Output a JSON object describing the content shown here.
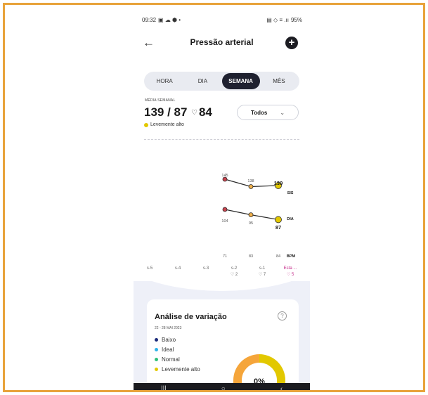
{
  "status_bar": {
    "time": "09:32",
    "left_icons": "▣ ☁ ⬢ •",
    "right_icons": "▤ ◇ ≡ .ıı",
    "battery": "95%"
  },
  "header": {
    "title": "Pressão arterial",
    "back_icon": "←",
    "add_icon": "+"
  },
  "tabs": [
    {
      "label": "HORA",
      "active": false
    },
    {
      "label": "DIA",
      "active": false
    },
    {
      "label": "SEMANA",
      "active": true
    },
    {
      "label": "MÊS",
      "active": false
    }
  ],
  "summary": {
    "period_label": "MÉDIA SEMANAL",
    "bp": "139 / 87",
    "hr": "84",
    "heart_icon": "♡",
    "status": "Levemente alto",
    "status_color": "#e2c800"
  },
  "filter": {
    "selected": "Todos",
    "chevron": "⌄"
  },
  "chart_data": {
    "type": "line",
    "categories": [
      "s-2",
      "s-1",
      "Esta semana"
    ],
    "series": [
      {
        "name": "SIS",
        "values": [
          145,
          138,
          139
        ],
        "color": "#c8434e"
      },
      {
        "name": "DIA",
        "values": [
          104,
          95,
          87
        ],
        "color": "#c8434e"
      }
    ],
    "bpm": [
      71,
      83,
      84
    ],
    "bpm_label": "BPM",
    "labels": {
      "s2_sis": "145",
      "s1_sis": "138",
      "cur_sis": "139",
      "sis_tag": "SIS",
      "s2_dia": "104",
      "s1_dia": "95",
      "cur_dia": "87",
      "dia_tag": "DIA",
      "bpm0": "71",
      "bpm1": "83",
      "bpm2": "84"
    }
  },
  "weeks": [
    {
      "label": "s-5",
      "sub": ""
    },
    {
      "label": "s-4",
      "sub": ""
    },
    {
      "label": "s-3",
      "sub": ""
    },
    {
      "label": "s-2",
      "sub": "♡ 2"
    },
    {
      "label": "s-1",
      "sub": "♡ 7"
    },
    {
      "label": "Esta ...",
      "sub": "♡ 5"
    }
  ],
  "analysis": {
    "title": "Análise de variação",
    "help_icon": "?",
    "date_range": "22 - 28 MAI 2023",
    "legend": [
      {
        "label": "Baixo",
        "color": "#1b2a7a"
      },
      {
        "label": "Ideal",
        "color": "#2eb2e8"
      },
      {
        "label": "Normal",
        "color": "#2fc07a"
      },
      {
        "label": "Levemente alto",
        "color": "#e2c800"
      }
    ],
    "donut_center": "0%",
    "donut_colors": [
      "#f5a53a",
      "#e2c800"
    ]
  },
  "nav": {
    "recents": "|||",
    "home": "○",
    "back": "‹"
  },
  "colors": {
    "frame": "#e8a33b",
    "accent": "#1f2130",
    "point_fill": "#e2c800"
  }
}
